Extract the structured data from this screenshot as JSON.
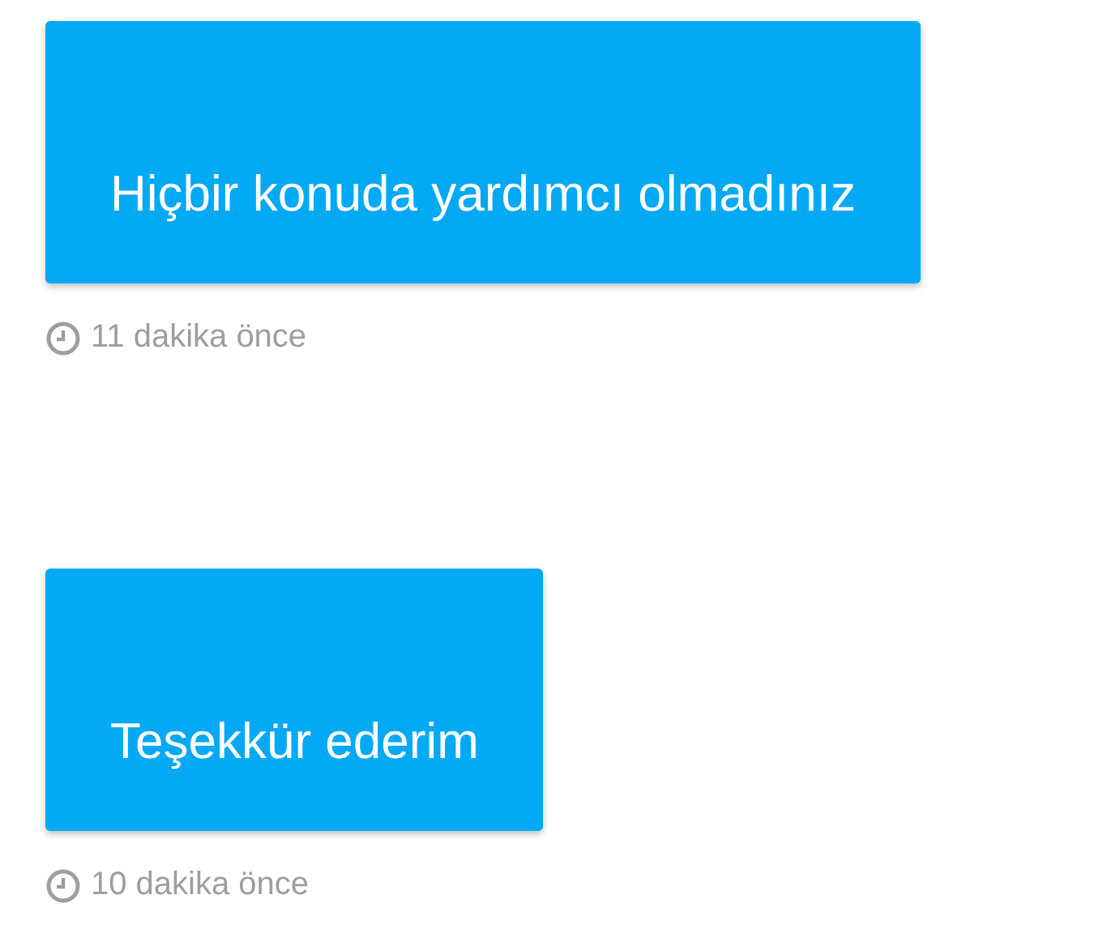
{
  "messages": [
    {
      "text": "Hiçbir konuda yardımcı olmadınız",
      "time": "11 dakika önce"
    },
    {
      "text": "Teşekkür ederim",
      "time": "10 dakika önce"
    }
  ]
}
